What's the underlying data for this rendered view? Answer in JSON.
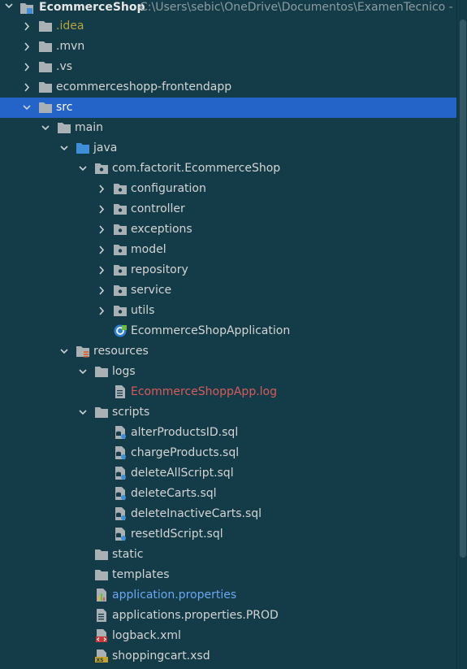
{
  "colors": {
    "background": "#133c48",
    "selection": "#2463c8",
    "text": "#d4d4d4",
    "path": "#8d9ba0",
    "ignored": "#b4a340",
    "error": "#d85a5a",
    "modified": "#6ca7f0",
    "folder": "#a9b1b5",
    "source_folder": "#3f8fd8"
  },
  "project": {
    "name": "EcommerceShop",
    "path": "C:\\Users\\sebic\\OneDrive\\Documentos\\ExamenTecnico - Fac"
  },
  "tree": [
    {
      "label": ".idea",
      "depth": 0,
      "icon": "folder-icon",
      "expander": "collapsed",
      "color": "ignored"
    },
    {
      "label": ".mvn",
      "depth": 0,
      "icon": "folder-icon",
      "expander": "collapsed"
    },
    {
      "label": ".vs",
      "depth": 0,
      "icon": "folder-icon",
      "expander": "collapsed"
    },
    {
      "label": "ecommerceshopp-frontendapp",
      "depth": 0,
      "icon": "folder-icon",
      "expander": "collapsed"
    },
    {
      "label": "src",
      "depth": 0,
      "icon": "folder-icon",
      "expander": "expanded",
      "selected": true
    },
    {
      "label": "main",
      "depth": 1,
      "icon": "folder-icon",
      "expander": "expanded"
    },
    {
      "label": "java",
      "depth": 2,
      "icon": "source-folder-icon",
      "expander": "expanded"
    },
    {
      "label": "com.factorit.EcommerceShop",
      "depth": 3,
      "icon": "package-icon",
      "expander": "expanded"
    },
    {
      "label": "configuration",
      "depth": 4,
      "icon": "package-icon",
      "expander": "collapsed"
    },
    {
      "label": "controller",
      "depth": 4,
      "icon": "package-icon",
      "expander": "collapsed"
    },
    {
      "label": "exceptions",
      "depth": 4,
      "icon": "package-icon",
      "expander": "collapsed"
    },
    {
      "label": "model",
      "depth": 4,
      "icon": "package-icon",
      "expander": "collapsed"
    },
    {
      "label": "repository",
      "depth": 4,
      "icon": "package-icon",
      "expander": "collapsed"
    },
    {
      "label": "service",
      "depth": 4,
      "icon": "package-icon",
      "expander": "collapsed"
    },
    {
      "label": "utils",
      "depth": 4,
      "icon": "package-icon",
      "expander": "collapsed"
    },
    {
      "label": "EcommerceShopApplication",
      "depth": 4,
      "icon": "spring-boot-class-icon",
      "expander": "none"
    },
    {
      "label": "resources",
      "depth": 2,
      "icon": "resources-folder-icon",
      "expander": "expanded"
    },
    {
      "label": "logs",
      "depth": 3,
      "icon": "folder-icon",
      "expander": "expanded"
    },
    {
      "label": "EcommerceShoppApp.log",
      "depth": 4,
      "icon": "text-file-icon",
      "expander": "none",
      "color": "error"
    },
    {
      "label": "scripts",
      "depth": 3,
      "icon": "folder-icon",
      "expander": "expanded"
    },
    {
      "label": "alterProductsID.sql",
      "depth": 4,
      "icon": "sql-file-icon",
      "expander": "none"
    },
    {
      "label": "chargeProducts.sql",
      "depth": 4,
      "icon": "sql-file-icon",
      "expander": "none"
    },
    {
      "label": "deleteAllScript.sql",
      "depth": 4,
      "icon": "sql-file-icon",
      "expander": "none"
    },
    {
      "label": "deleteCarts.sql",
      "depth": 4,
      "icon": "sql-file-icon",
      "expander": "none"
    },
    {
      "label": "deleteInactiveCarts.sql",
      "depth": 4,
      "icon": "sql-file-icon",
      "expander": "none"
    },
    {
      "label": "resetIdScript.sql",
      "depth": 4,
      "icon": "sql-file-icon",
      "expander": "none"
    },
    {
      "label": "static",
      "depth": 3,
      "icon": "folder-icon",
      "expander": "none"
    },
    {
      "label": "templates",
      "depth": 3,
      "icon": "folder-icon",
      "expander": "none"
    },
    {
      "label": "application.properties",
      "depth": 3,
      "icon": "properties-file-icon",
      "expander": "none",
      "color": "modified"
    },
    {
      "label": "applications.properties.PROD",
      "depth": 3,
      "icon": "text-file-icon",
      "expander": "none"
    },
    {
      "label": "logback.xml",
      "depth": 3,
      "icon": "xml-file-icon",
      "expander": "none"
    },
    {
      "label": "shoppingcart.xsd",
      "depth": 3,
      "icon": "xsd-file-icon",
      "expander": "none"
    }
  ]
}
